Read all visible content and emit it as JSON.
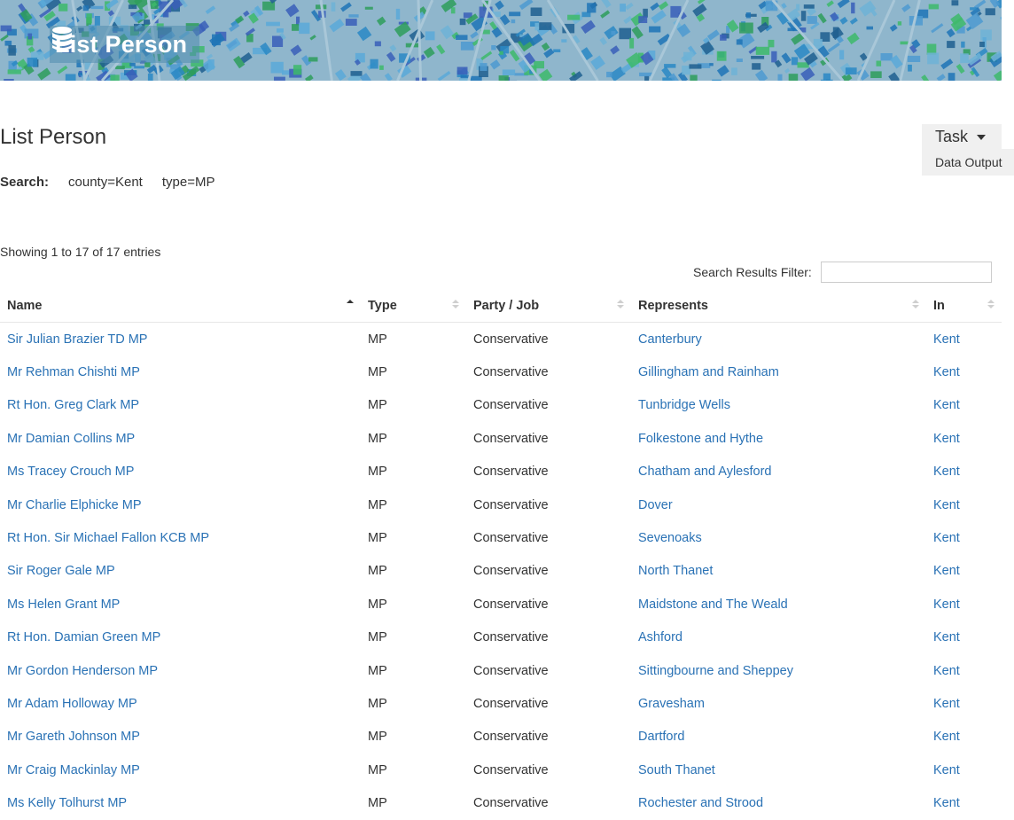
{
  "banner": {
    "title": "List Person"
  },
  "page": {
    "title": "List Person"
  },
  "search": {
    "label": "Search:",
    "criteria": [
      "county=Kent",
      "type=MP"
    ]
  },
  "task_menu": {
    "label": "Task",
    "items": [
      "Data Output"
    ]
  },
  "table_info": "Showing 1 to 17 of 17 entries",
  "filter": {
    "label": "Search Results Filter:",
    "value": ""
  },
  "table": {
    "columns": [
      "Name",
      "Type",
      "Party / Job",
      "Represents",
      "In"
    ],
    "sorted_column": "Name",
    "rows": [
      [
        "Sir Julian Brazier TD MP",
        "MP",
        "Conservative",
        "Canterbury",
        "Kent"
      ],
      [
        "Mr Rehman Chishti MP",
        "MP",
        "Conservative",
        "Gillingham and Rainham",
        "Kent"
      ],
      [
        "Rt Hon. Greg Clark MP",
        "MP",
        "Conservative",
        "Tunbridge Wells",
        "Kent"
      ],
      [
        "Mr Damian Collins MP",
        "MP",
        "Conservative",
        "Folkestone and Hythe",
        "Kent"
      ],
      [
        "Ms Tracey Crouch MP",
        "MP",
        "Conservative",
        "Chatham and Aylesford",
        "Kent"
      ],
      [
        "Mr Charlie Elphicke MP",
        "MP",
        "Conservative",
        "Dover",
        "Kent"
      ],
      [
        "Rt Hon. Sir Michael Fallon KCB MP",
        "MP",
        "Conservative",
        "Sevenoaks",
        "Kent"
      ],
      [
        "Sir Roger Gale MP",
        "MP",
        "Conservative",
        "North Thanet",
        "Kent"
      ],
      [
        "Ms Helen Grant MP",
        "MP",
        "Conservative",
        "Maidstone and The Weald",
        "Kent"
      ],
      [
        "Rt Hon. Damian Green MP",
        "MP",
        "Conservative",
        "Ashford",
        "Kent"
      ],
      [
        "Mr Gordon Henderson MP",
        "MP",
        "Conservative",
        "Sittingbourne and Sheppey",
        "Kent"
      ],
      [
        "Mr Adam Holloway MP",
        "MP",
        "Conservative",
        "Gravesham",
        "Kent"
      ],
      [
        "Mr Gareth Johnson MP",
        "MP",
        "Conservative",
        "Dartford",
        "Kent"
      ],
      [
        "Mr Craig Mackinlay MP",
        "MP",
        "Conservative",
        "South Thanet",
        "Kent"
      ],
      [
        "Ms Kelly Tolhurst MP",
        "MP",
        "Conservative",
        "Rochester and Strood",
        "Kent"
      ]
    ]
  },
  "colors": {
    "link": "#2a72b5",
    "text": "#333333",
    "banner_bg": "#8fb6cc",
    "menu_bg": "#f0f0f0"
  }
}
